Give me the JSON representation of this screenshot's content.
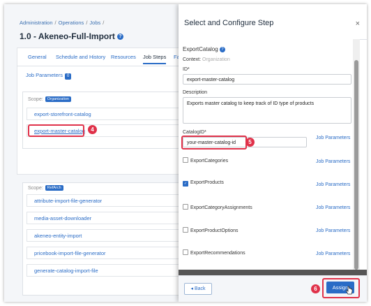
{
  "breadcrumb": [
    "Administration",
    "Operations",
    "Jobs"
  ],
  "breadcrumb_current": "",
  "page_title": "1.0 - Akeneo-Full-Import",
  "tabs": [
    "General",
    "Schedule and History",
    "Resources",
    "Job Steps",
    "Fa"
  ],
  "job_parameters": {
    "label": "Job Parameters",
    "count": "0"
  },
  "scope_org": {
    "label": "Scope:",
    "badge": "Organization",
    "items": [
      "export-storefront-catalog",
      "export-master-catalog"
    ]
  },
  "scope_ref": {
    "label": "Scope:",
    "badge": "RefArch",
    "items": [
      "attribute-import-file-generator",
      "media-asset-downloader",
      "akeneo-entity-import",
      "pricebook-import-file-generator",
      "generate-catalog-import-file"
    ]
  },
  "modal": {
    "title": "Select and Configure Step",
    "close": "×",
    "step_name": "ExportCatalog",
    "context_label": "Context:",
    "context_value": "Organization",
    "id_label": "ID*",
    "id_value": "export-master-catalog",
    "description_label": "Description",
    "description_value": "Exports master catalog to keep track of ID type of products",
    "catalogid_label": "CatalogID*",
    "catalogid_value": "your-master-catalog-id",
    "job_param_link": "Job Parameters",
    "checkboxes": [
      {
        "label": "ExportCategories",
        "checked": false
      },
      {
        "label": "ExportProducts",
        "checked": true
      },
      {
        "label": "ExportCategoryAssignments",
        "checked": false
      },
      {
        "label": "ExportProductOptions",
        "checked": false
      },
      {
        "label": "ExportRecommendations",
        "checked": false
      }
    ],
    "back_label": "◂ Back",
    "assign_label": "Assign"
  },
  "annotations": [
    "4",
    "5",
    "6"
  ],
  "colors": {
    "accent": "#2a6cc6",
    "highlight": "#e0324a"
  }
}
